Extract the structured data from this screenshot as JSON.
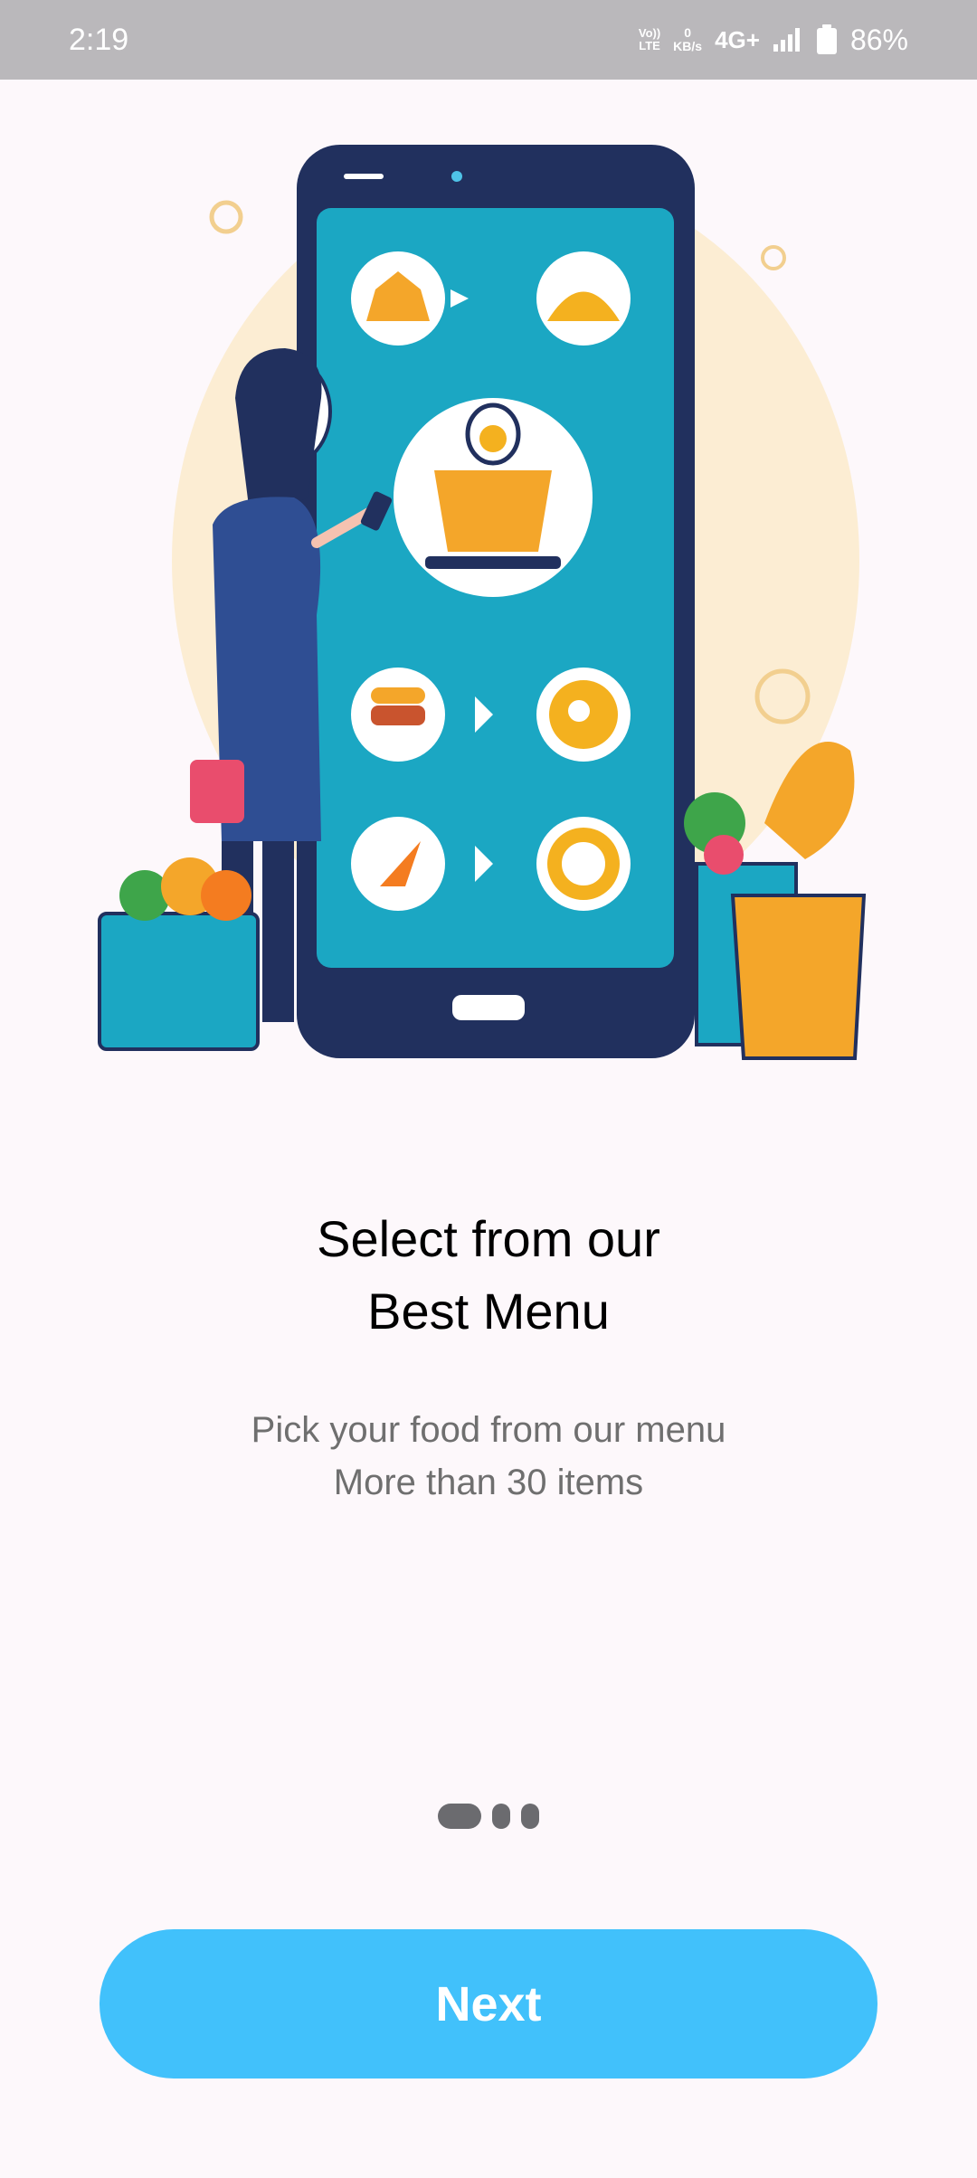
{
  "status_bar": {
    "time": "2:19",
    "volte_top": "Vo))",
    "volte_bottom": "LTE",
    "data_rate_value": "0",
    "data_rate_unit": "KB/s",
    "network": "4G+",
    "battery_level": "86%",
    "icons": [
      "volte-icon",
      "signal-icon",
      "battery-icon"
    ]
  },
  "onboarding": {
    "title_line1": "Select from our",
    "title_line2": "Best Menu",
    "subtitle_line1": "Pick your food from our menu",
    "subtitle_line2": "More than 30 items",
    "page_indicator": {
      "total": 3,
      "active_index": 0
    },
    "next_label": "Next"
  },
  "colors": {
    "accent": "#41c1fb",
    "status_bar": "#bab8bb",
    "background": "#fdf8fb"
  }
}
